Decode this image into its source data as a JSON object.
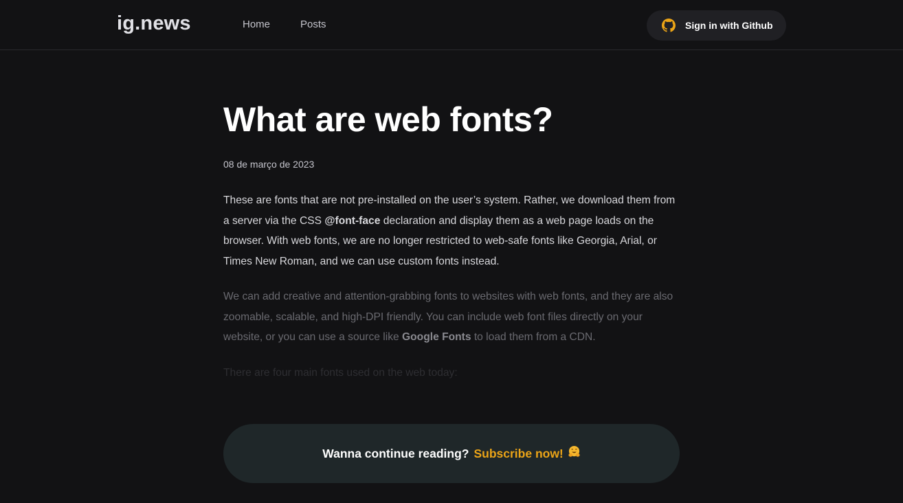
{
  "header": {
    "logo": "ig.news",
    "nav": [
      "Home",
      "Posts"
    ],
    "signin_label": "Sign in with Github",
    "signin_icon": "github-icon"
  },
  "article": {
    "title": "What are web fonts?",
    "date": "08 de março de 2023",
    "p1": {
      "before": "These are fonts that are not pre-installed on the user’s system. Rather, we download them from a server via the CSS ",
      "bold": "@font-face",
      "after": " declaration and display them as a web page loads on the browser. With web fonts, we are no longer restricted to web-safe fonts like Georgia, Arial, or Times New Roman, and we can use custom fonts instead."
    },
    "p2": {
      "before": "We can add creative and attention-grabbing fonts to websites with web fonts, and they are also zoomable, scalable, and high-DPI friendly. You can include web font files directly on your website, or you can use a source like ",
      "bold": "Google Fonts",
      "after": " to load them from a CDN."
    },
    "p3": "There are four main fonts used on the web today:"
  },
  "cta": {
    "text": "Wanna continue reading?",
    "link": "Subscribe now!",
    "emoji": "hugging-face-emoji"
  },
  "colors": {
    "background": "#121214",
    "accent": "#eba417",
    "cta_background": "#1f2729",
    "button_background": "#202024"
  }
}
